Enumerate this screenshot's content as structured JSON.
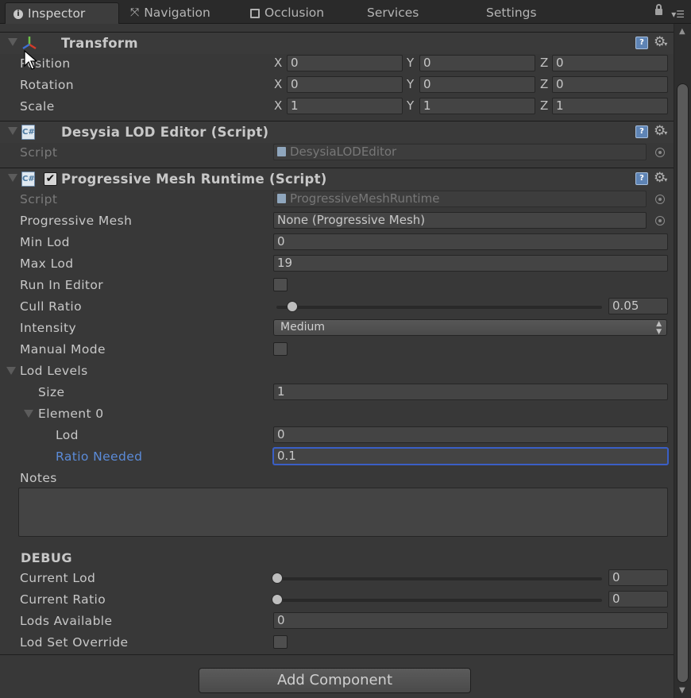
{
  "tabs": [
    {
      "label": "Inspector",
      "icon": "info-icon"
    },
    {
      "label": "Navigation",
      "icon": "navigation-icon"
    },
    {
      "label": "Occlusion",
      "icon": "occlusion-icon"
    },
    {
      "label": "Services"
    },
    {
      "label": "Settings"
    }
  ],
  "transform": {
    "title": "Transform",
    "rows": [
      {
        "label": "Position",
        "x": "0",
        "y": "0",
        "z": "0"
      },
      {
        "label": "Rotation",
        "x": "0",
        "y": "0",
        "z": "0"
      },
      {
        "label": "Scale",
        "x": "1",
        "y": "1",
        "z": "1"
      }
    ],
    "axis_labels": {
      "x": "X",
      "y": "Y",
      "z": "Z"
    }
  },
  "lod_editor": {
    "title": "Desysia LOD Editor (Script)",
    "script_label": "Script",
    "script_value": "DesysiaLODEditor"
  },
  "pmr": {
    "title": "Progressive Mesh Runtime (Script)",
    "enabled_glyph": "✔",
    "script_label": "Script",
    "script_value": "ProgressiveMeshRuntime",
    "progressive_mesh_label": "Progressive Mesh",
    "progressive_mesh_value": "None (Progressive Mesh)",
    "min_lod_label": "Min Lod",
    "min_lod_value": "0",
    "max_lod_label": "Max Lod",
    "max_lod_value": "19",
    "run_in_editor_label": "Run In Editor",
    "run_in_editor_checked": false,
    "cull_ratio_label": "Cull Ratio",
    "cull_ratio_value": "0.05",
    "intensity_label": "Intensity",
    "intensity_value": "Medium",
    "manual_mode_label": "Manual Mode",
    "manual_mode_checked": false,
    "lod_levels_label": "Lod Levels",
    "size_label": "Size",
    "size_value": "1",
    "element0_label": "Element 0",
    "lod_label": "Lod",
    "lod_value": "0",
    "ratio_needed_label": "Ratio Needed",
    "ratio_needed_value": "0.1",
    "notes_label": "Notes",
    "notes_value": "",
    "debug_label": "DEBUG",
    "current_lod_label": "Current Lod",
    "current_lod_value": "0",
    "current_ratio_label": "Current Ratio",
    "current_ratio_value": "0",
    "lods_available_label": "Lods Available",
    "lods_available_value": "0",
    "lod_set_override_label": "Lod Set Override",
    "lod_set_override_checked": false
  },
  "add_component_label": "Add Component",
  "colors": {
    "background": "#383838",
    "active_label": "#5b8bd8",
    "focus_border": "#3a5fc6",
    "help_icon": "#5e84b5"
  }
}
